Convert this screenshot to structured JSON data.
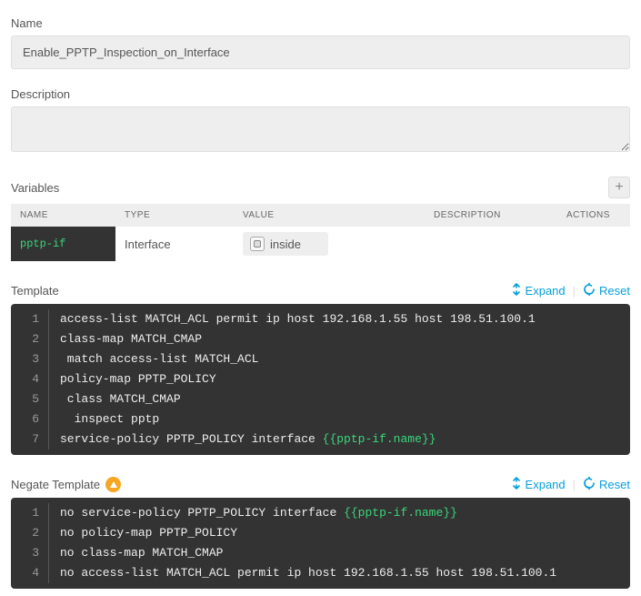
{
  "name": {
    "label": "Name",
    "value": "Enable_PPTP_Inspection_on_Interface"
  },
  "description": {
    "label": "Description",
    "value": ""
  },
  "variables": {
    "label": "Variables",
    "columns": {
      "name": "NAME",
      "type": "TYPE",
      "value": "VALUE",
      "description": "DESCRIPTION",
      "actions": "ACTIONS"
    },
    "rows": [
      {
        "name": "pptp-if",
        "type": "Interface",
        "value": "inside",
        "description": ""
      }
    ]
  },
  "template": {
    "label": "Template",
    "expand": "Expand",
    "reset": "Reset",
    "lines": [
      {
        "n": "1",
        "segs": [
          {
            "t": "access-list MATCH_ACL permit ip host 192.168.1.55 host 198.51.100.1"
          }
        ]
      },
      {
        "n": "2",
        "segs": [
          {
            "t": "class-map MATCH_CMAP"
          }
        ]
      },
      {
        "n": "3",
        "segs": [
          {
            "t": " match access-list MATCH_ACL"
          }
        ]
      },
      {
        "n": "4",
        "segs": [
          {
            "t": "policy-map PPTP_POLICY"
          }
        ]
      },
      {
        "n": "5",
        "segs": [
          {
            "t": " class MATCH_CMAP"
          }
        ]
      },
      {
        "n": "6",
        "segs": [
          {
            "t": "  inspect pptp"
          }
        ]
      },
      {
        "n": "7",
        "segs": [
          {
            "t": "service-policy PPTP_POLICY interface "
          },
          {
            "t": "{{pptp-if.name}}",
            "var": true
          }
        ]
      }
    ]
  },
  "negate": {
    "label": "Negate Template",
    "expand": "Expand",
    "reset": "Reset",
    "lines": [
      {
        "n": "1",
        "segs": [
          {
            "t": "no service-policy PPTP_POLICY interface "
          },
          {
            "t": "{{pptp-if.name}}",
            "var": true
          }
        ]
      },
      {
        "n": "2",
        "segs": [
          {
            "t": "no policy-map PPTP_POLICY"
          }
        ]
      },
      {
        "n": "3",
        "segs": [
          {
            "t": "no class-map MATCH_CMAP"
          }
        ]
      },
      {
        "n": "4",
        "segs": [
          {
            "t": "no access-list MATCH_ACL permit ip host 192.168.1.55 host 198.51.100.1"
          }
        ]
      }
    ]
  }
}
